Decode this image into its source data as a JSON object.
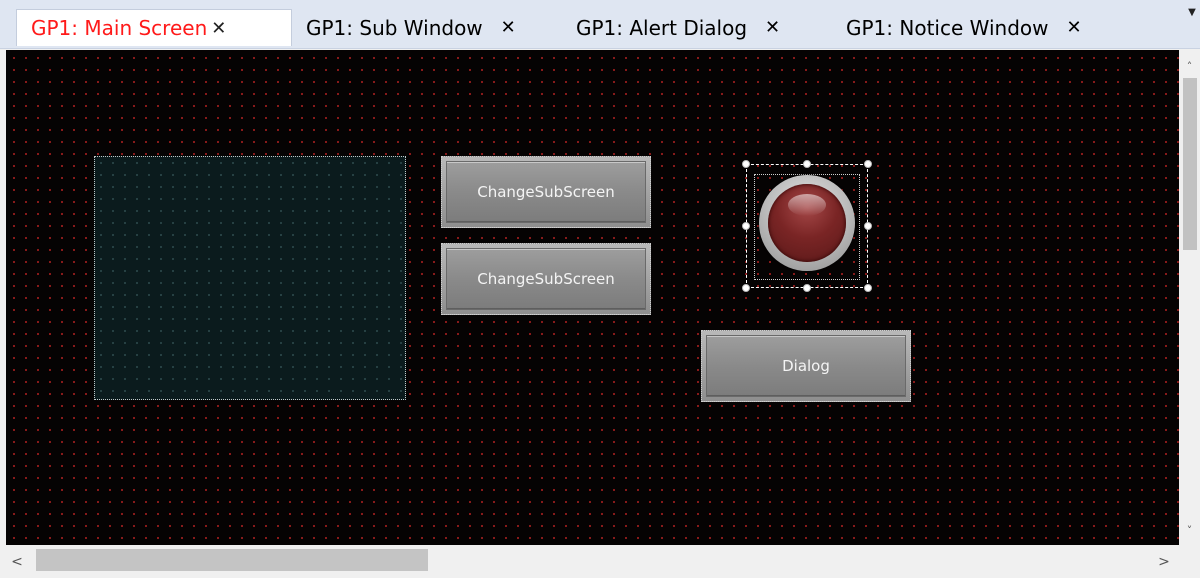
{
  "tabs": [
    {
      "label": "GP1: Main Screen",
      "active": true
    },
    {
      "label": "GP1: Sub Window",
      "active": false
    },
    {
      "label": "GP1: Alert Dialog",
      "active": false
    },
    {
      "label": "GP1: Notice Window",
      "active": false
    }
  ],
  "close_glyph": "✕",
  "more_glyph": "▼",
  "canvas": {
    "buttons": {
      "change_sub_1": "ChangeSubScreen",
      "change_sub_2": "ChangeSubScreen",
      "dialog": "Dialog"
    },
    "lamp_color": "#7a2525",
    "grid_dot_color": "#9b1d1d"
  },
  "scroll": {
    "up": "˄",
    "down": "˅",
    "left": "<",
    "right": ">"
  },
  "colors": {
    "active_tab_text": "#ff1a1a",
    "canvas_background": "#050303"
  }
}
